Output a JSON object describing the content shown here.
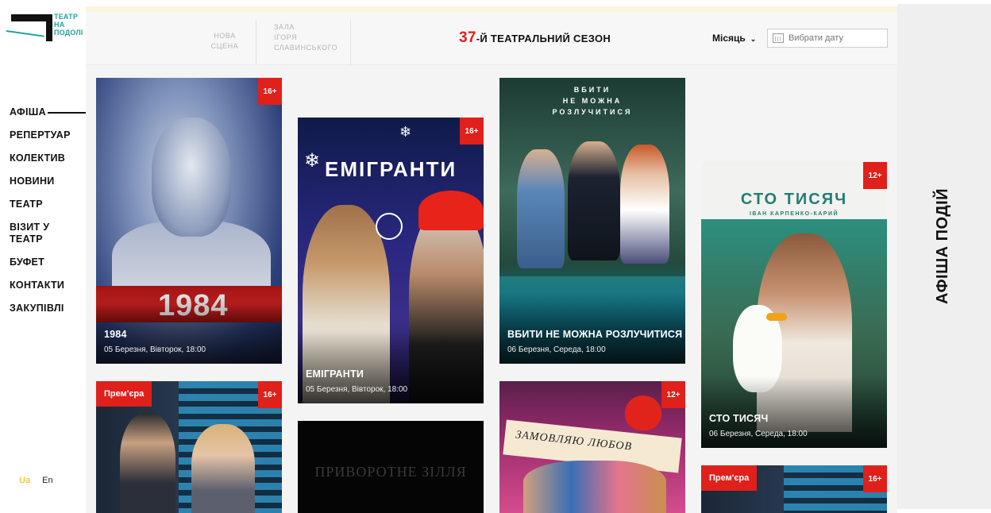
{
  "logo": {
    "line1": "ТЕАТР",
    "line2": "НА",
    "line3": "ПОДОЛІ"
  },
  "nav": {
    "items": [
      {
        "label": "АФІША",
        "active": true
      },
      {
        "label": "РЕПЕРТУАР"
      },
      {
        "label": "КОЛЕКТИВ"
      },
      {
        "label": "НОВИНИ"
      },
      {
        "label": "ТЕАТР"
      },
      {
        "label": "ВІЗИТ У ТЕАТР"
      },
      {
        "label": "БУФЕТ"
      },
      {
        "label": "КОНТАКТИ"
      },
      {
        "label": "ЗАКУПІВЛІ"
      }
    ]
  },
  "lang": {
    "ua": "Ua",
    "en": "En",
    "active": "Ua",
    "active_color": "#f0b400"
  },
  "header": {
    "stage1_line1": "НОВА",
    "stage1_line2": "СЦЕНА",
    "stage2_line1": "ЗАЛА",
    "stage2_line2": "ІГОРЯ",
    "stage2_line3": "СЛАВИНСЬКОГО",
    "season_number": "37",
    "season_text": "-Й ТЕАТРАЛЬНИЙ СЕЗОН",
    "month_label": "Місяць",
    "date_placeholder": "Вибрати дату"
  },
  "cards": [
    {
      "title": "1984",
      "date": "05 Березня, Вівторок, 18:00",
      "age": "16+",
      "poster_text": "1984"
    },
    {
      "title": "ЕМІГРАНТИ",
      "date": "05 Березня, Вівторок, 18:00",
      "age": "16+",
      "poster_text": "ЕМІГРАНТИ"
    },
    {
      "title": "ВБИТИ НЕ МОЖНА РОЗЛУЧИТИСЯ",
      "date": "06 Березня, Середа, 18:00",
      "age": "",
      "poster_l1": "ВБИТИ",
      "poster_l2": "НЕ МОЖНА",
      "poster_l3": "РОЗЛУЧИТИСЯ"
    },
    {
      "title": "СТО ТИСЯЧ",
      "date": "06 Березня, Середа, 18:00",
      "age": "12+",
      "poster_text": "СТО ТИСЯЧ",
      "poster_sub": "ІВАН КАРПЕНКО-КАРИЙ"
    },
    {
      "badge": "Прем'єра",
      "age": "16+"
    },
    {
      "poster_text": "ПРИВОРОТНЕ ЗІЛЛЯ"
    },
    {
      "age": "12+",
      "poster_text": "ЗАМОВЛЯЮ ЛЮБОВ"
    },
    {
      "badge": "Прем'єра",
      "age": "16+"
    }
  ],
  "right_panel": {
    "title": "АФІША ПОДІЙ"
  },
  "colors": {
    "accent_red": "#e0201b",
    "logo_teal": "#1fa3a0",
    "lang_active": "#f0b400"
  }
}
